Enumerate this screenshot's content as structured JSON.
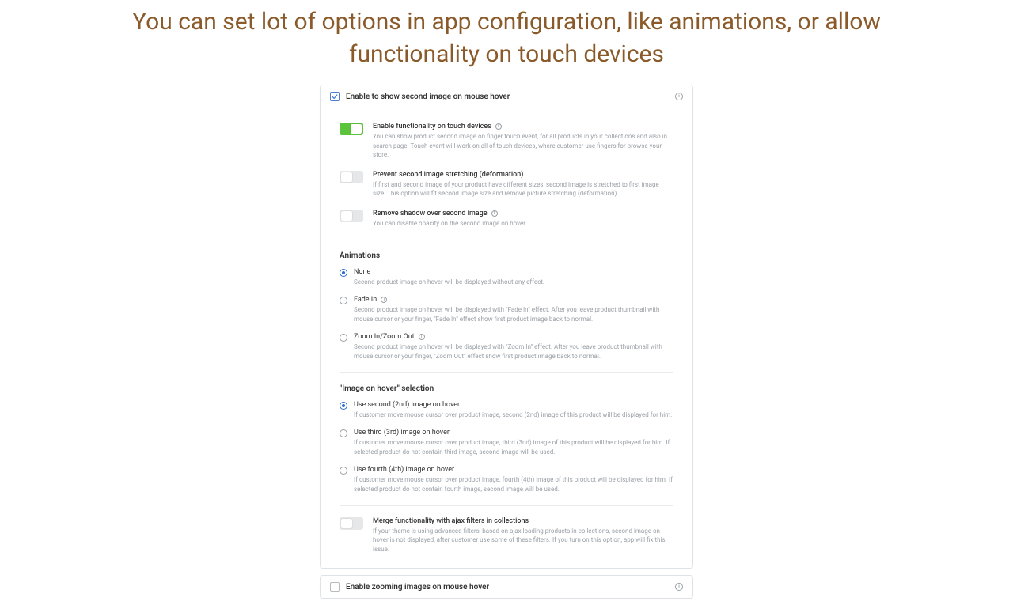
{
  "headline": "You can set lot of options in app configuration, like animations, or allow functionality on touch devices",
  "card1": {
    "checked": true,
    "title": "Enable to show second image on mouse hover",
    "toggles": [
      {
        "on": true,
        "label": "Enable functionality on touch devices",
        "info": true,
        "desc": "You can show product second image on finger touch event, for all products in your collections and also in search page. Touch event will work on all of touch devices, where customer use fingers for browse your store."
      },
      {
        "on": false,
        "label": "Prevent second image stretching (deformation)",
        "info": false,
        "desc": "If first and second image of your product have different sizes, second image is stretched to first image size. This option will fit second image size and remove picture stretching (deformation)."
      },
      {
        "on": false,
        "label": "Remove shadow over second image",
        "info": true,
        "desc": "You can disable opacity on the second image on hover."
      }
    ],
    "animations": {
      "title": "Animations",
      "options": [
        {
          "selected": true,
          "label": "None",
          "info": false,
          "desc": "Second product image on hover will be displayed without any effect."
        },
        {
          "selected": false,
          "label": "Fade In",
          "info": true,
          "desc": "Second product image on hover will be displayed with \"Fade In\" effect. After you leave product thumbnail with mouse cursor or your finger, \"Fade In\" effect show first product image back to normal."
        },
        {
          "selected": false,
          "label": "Zoom In/Zoom Out",
          "info": true,
          "desc": "Second product image on hover will be displayed with \"Zoom In\" effect. After you leave product thumbnail with mouse cursor or your finger, \"Zoom Out\" effect show first product image back to normal."
        }
      ]
    },
    "selection": {
      "title": "\"Image on hover\" selection",
      "options": [
        {
          "selected": true,
          "label": "Use second (2nd) image on hover",
          "desc": "If customer move mouse cursor over product image, second (2nd) image of this product will be displayed for him."
        },
        {
          "selected": false,
          "label": "Use third (3rd) image on hover",
          "desc": "If customer move mouse cursor over product image, third (3nd) image of this product will be displayed for him. If selected product do not contain third image, second image will be used."
        },
        {
          "selected": false,
          "label": "Use fourth (4th) image on hover",
          "desc": "If customer move mouse cursor over product image, fourth (4th) image of this product will be displayed for him. If selected product do not contain fourth image, second image will be used."
        }
      ]
    },
    "merge": {
      "on": false,
      "label": "Merge functionality with ajax filters in collections",
      "desc": "If your theme is using advanced filters, based on ajax loading products in collections, second image on hover is not displayed, after customer use some of these filters. If you turn on this option, app will fix this issue."
    }
  },
  "card2": {
    "checked": false,
    "title": "Enable zooming images on mouse hover"
  }
}
